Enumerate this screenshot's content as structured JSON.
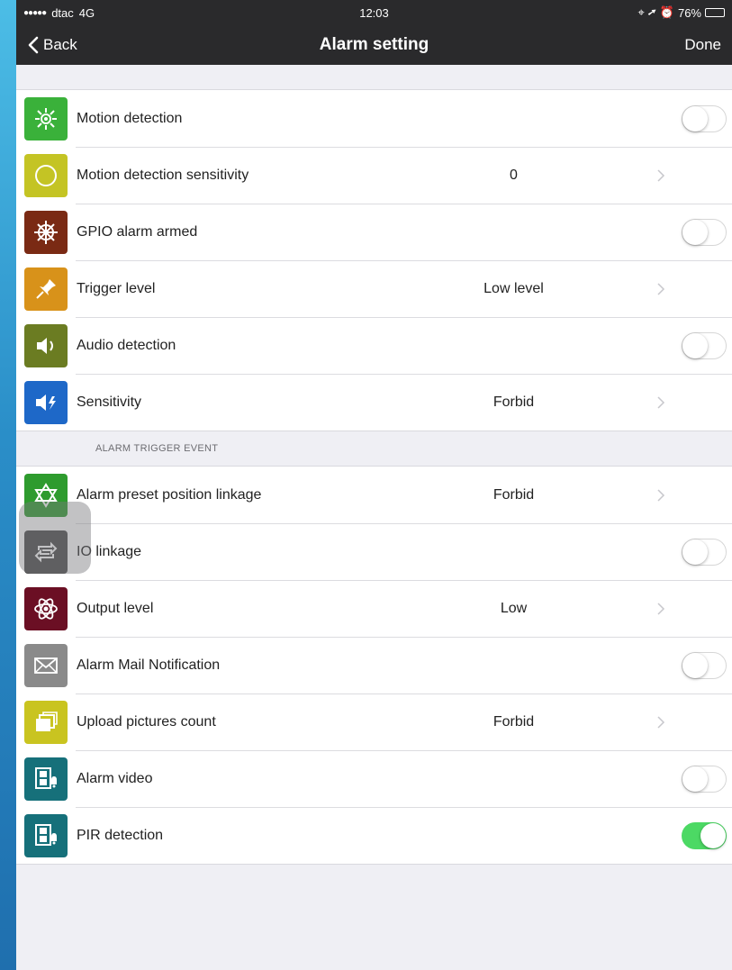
{
  "status_bar": {
    "carrier": "dtac",
    "network": "4G",
    "time": "12:03",
    "battery": "76%",
    "battery_level": 0.76
  },
  "nav": {
    "back_label": "Back",
    "title": "Alarm setting",
    "done_label": "Done"
  },
  "colors": {
    "toggle_on": "#4cd964",
    "navbar_bg": "#2a2a2c"
  },
  "groups": [
    {
      "header": "",
      "rows": [
        {
          "label": "Motion detection",
          "icon": "motion-sensor-icon",
          "icon_color": "#3ab13a",
          "control": "toggle",
          "on": false
        },
        {
          "label": "Motion detection sensitivity",
          "icon": "circle-icon",
          "icon_color": "#c4c424",
          "control": "value",
          "value": "0"
        },
        {
          "label": "GPIO alarm armed",
          "icon": "wheel-icon",
          "icon_color": "#7a2a14",
          "control": "toggle",
          "on": false
        },
        {
          "label": "Trigger level",
          "icon": "pin-icon",
          "icon_color": "#d8921a",
          "control": "value",
          "value": "Low level"
        },
        {
          "label": "Audio detection",
          "icon": "speaker-icon",
          "icon_color": "#6b7c22",
          "control": "toggle",
          "on": false
        },
        {
          "label": "Sensitivity",
          "icon": "speaker-bolt-icon",
          "icon_color": "#1e68c8",
          "control": "value",
          "value": "Forbid"
        }
      ]
    },
    {
      "header": "ALARM TRIGGER EVENT",
      "rows": [
        {
          "label": "Alarm preset position linkage",
          "icon": "star-of-david-icon",
          "icon_color": "#2e9b2e",
          "control": "value",
          "value": "Forbid"
        },
        {
          "label": "IO linkage",
          "icon": "repeat-icon",
          "icon_color": "#4b4b4b",
          "control": "toggle",
          "on": false
        },
        {
          "label": "Output level",
          "icon": "atom-icon",
          "icon_color": "#6b0f24",
          "control": "value",
          "value": "Low"
        },
        {
          "label": "Alarm Mail Notification",
          "icon": "mail-icon",
          "icon_color": "#8a8a8a",
          "control": "toggle",
          "on": false
        },
        {
          "label": "Upload pictures count",
          "icon": "pictures-icon",
          "icon_color": "#c9c420",
          "control": "value",
          "value": "Forbid"
        },
        {
          "label": "Alarm video",
          "icon": "film-bell-icon",
          "icon_color": "#16707a",
          "control": "toggle",
          "on": false
        },
        {
          "label": "PIR detection",
          "icon": "film-bell-icon",
          "icon_color": "#16707a",
          "control": "toggle",
          "on": true
        }
      ]
    }
  ]
}
